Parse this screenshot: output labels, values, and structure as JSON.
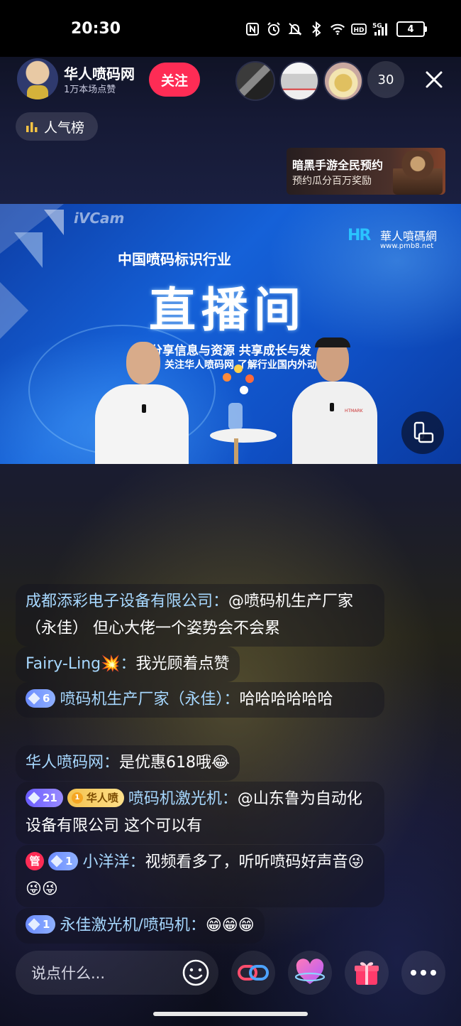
{
  "status_bar": {
    "time": "20:30",
    "battery": "4",
    "network": "5G"
  },
  "header": {
    "host_name": "华人喷码网",
    "host_likes": "1万本场点赞",
    "follow_label": "关注",
    "viewer_count": "30",
    "rank_label": "人气榜"
  },
  "ad": {
    "title": "暗黑手游全民预约",
    "subtitle": "预约瓜分百万奖励"
  },
  "video": {
    "watermark": "iVCam",
    "logo_text": "華人噴碼網",
    "logo_url": "www.pmb8.net",
    "subtitle": "中国喷码标识行业",
    "title": "直播间",
    "line1": "分享信息与资源 共享成长与发",
    "line2": "关注华人喷码网 了解行业国内外动",
    "shirt_text": "HTMARK"
  },
  "chat": [
    {
      "user": "成都添彩电子设备有限公司：",
      "text": "@喷码机生产厂家（永佳） 但心大佬一个姿势会不会累"
    },
    {
      "user": "Fairy-Ling💥：",
      "text": "我光顾着点赞"
    },
    {
      "level": "6",
      "user": "喷码机生产厂家（永佳）：",
      "text": "哈哈哈哈哈哈"
    },
    {
      "user": "华人喷码网：",
      "text": "是优惠618哦😂"
    },
    {
      "level": "21",
      "fan_badge": "华人喷",
      "fan_level": "1",
      "user": "喷码机激光机：",
      "text": "@山东鲁为自动化设备有限公司 这个可以有"
    },
    {
      "admin": "管",
      "level": "1",
      "user": "小洋洋：",
      "text": "视频看多了，听听喷码好声音😜😜😜"
    },
    {
      "level": "1",
      "user": "永佳激光机/喷码机：",
      "text": "😁😁😁"
    }
  ],
  "bottom": {
    "comment_placeholder": "说点什么..."
  },
  "icons": {
    "close": "close-icon",
    "rank": "bar-chart-icon",
    "emoji": "smiley-icon",
    "link": "link-icon",
    "heart": "heart-icon",
    "gift": "gift-icon",
    "more": "more-icon",
    "rotate": "rotate-screen-icon"
  },
  "colors": {
    "follow": "#fe2c55",
    "username": "#a7d8ff",
    "video_bg": "#1561d8"
  }
}
